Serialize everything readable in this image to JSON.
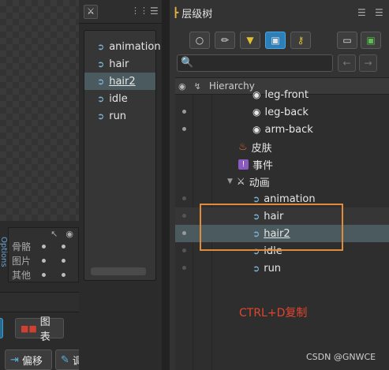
{
  "left_panel": {
    "visibility": {
      "rows": [
        {
          "label": "骨骼"
        },
        {
          "label": "图片"
        },
        {
          "label": "其他"
        }
      ],
      "side_tab": "Options"
    },
    "bottom_buttons": [
      {
        "label": "图表",
        "icon": "graph-icon"
      },
      {
        "label": "偏移",
        "icon": "offset-icon"
      },
      {
        "label": "调整",
        "icon": "adjust-icon"
      }
    ]
  },
  "animations_list": {
    "items": [
      {
        "label": "animation",
        "selected": false
      },
      {
        "label": "hair",
        "selected": false
      },
      {
        "label": "hair2",
        "selected": true
      },
      {
        "label": "idle",
        "selected": false
      },
      {
        "label": "run",
        "selected": false
      }
    ]
  },
  "tree": {
    "title": "层级树",
    "header_label": "Hierarchy",
    "rows": [
      {
        "label": "leg-front",
        "kind": "slot",
        "indent": 2,
        "eye": false
      },
      {
        "label": "leg-back",
        "kind": "slot",
        "indent": 2,
        "eye": true
      },
      {
        "label": "arm-back",
        "kind": "slot",
        "indent": 2,
        "eye": true
      },
      {
        "label": "皮肤",
        "kind": "skin",
        "indent": 1,
        "eye": false
      },
      {
        "label": "事件",
        "kind": "event",
        "indent": 1,
        "eye": false
      },
      {
        "label": "动画",
        "kind": "anim-folder",
        "indent": 1,
        "eye": false
      },
      {
        "label": "animation",
        "kind": "anim",
        "indent": 2,
        "eye": false
      },
      {
        "label": "hair",
        "kind": "anim",
        "indent": 2,
        "eye": false
      },
      {
        "label": "hair2",
        "kind": "anim",
        "indent": 2,
        "eye": true
      },
      {
        "label": "idle",
        "kind": "anim",
        "indent": 2,
        "eye": false
      },
      {
        "label": "run",
        "kind": "anim",
        "indent": 2,
        "eye": false
      }
    ]
  },
  "annotation": {
    "text": "CTRL+D复制",
    "color": "#e0452e",
    "box_color": "#e08a3a"
  },
  "watermark": "CSDN @GNWCE",
  "colors": {
    "selection": "#4b5a5e",
    "panel": "#333333",
    "accent": "#3a9bd8"
  }
}
